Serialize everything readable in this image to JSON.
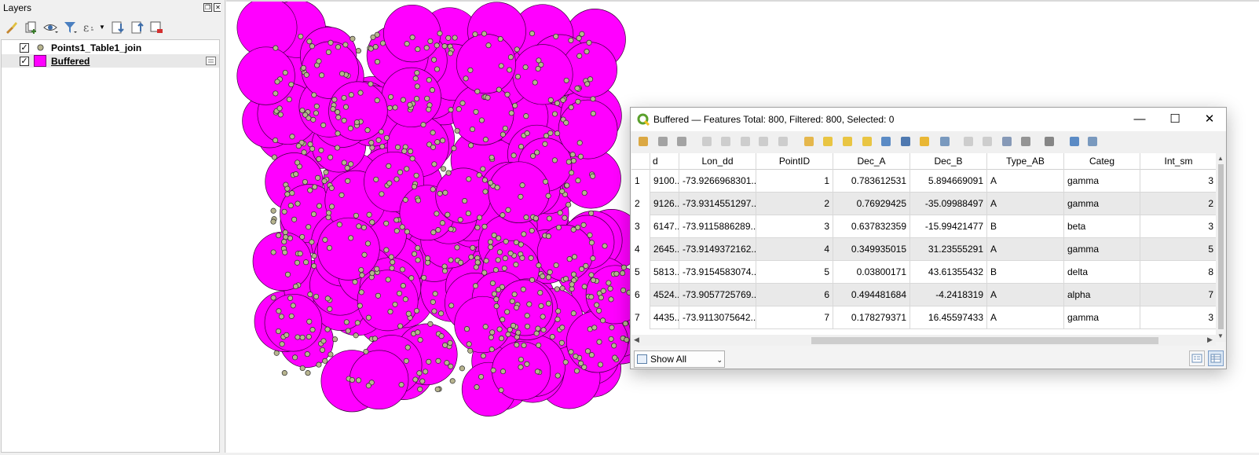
{
  "layers_panel": {
    "title": "Layers",
    "toolbar_icons": [
      "style-brush-icon",
      "add-group-icon",
      "visibility-eye-icon",
      "filter-icon",
      "expression-filter-icon",
      "expand-all-icon",
      "collapse-all-icon",
      "remove-layer-icon"
    ],
    "layers": [
      {
        "name": "Points1_Table1_join",
        "checked": true,
        "symbol": "point",
        "symbol_color": "#b7b48f",
        "selected": false
      },
      {
        "name": "Buffered",
        "checked": true,
        "symbol": "polygon",
        "symbol_color": "#ff00ff",
        "selected": true
      }
    ]
  },
  "map": {
    "polygon_fill": "#ff00ff",
    "polygon_stroke": "#3a003a",
    "point_fill": "#b7b48f",
    "point_stroke": "#2a2a2a"
  },
  "attribute_table": {
    "title": "Buffered — Features Total: 800, Filtered: 800, Selected: 0",
    "columns": [
      "d",
      "Lon_dd",
      "PointID",
      "Dec_A",
      "Dec_B",
      "Type_AB",
      "Categ",
      "Int_sm"
    ],
    "rows": [
      {
        "num": "1",
        "cells": [
          "9100...",
          "-73.9266968301...",
          "1",
          "0.783612531",
          "5.894669091",
          "A",
          "gamma",
          "3"
        ]
      },
      {
        "num": "2",
        "cells": [
          "9126...",
          "-73.9314551297...",
          "2",
          "0.76929425",
          "-35.09988497",
          "A",
          "gamma",
          "2"
        ]
      },
      {
        "num": "3",
        "cells": [
          "6147...",
          "-73.9115886289...",
          "3",
          "0.637832359",
          "-15.99421477",
          "B",
          "beta",
          "3"
        ]
      },
      {
        "num": "4",
        "cells": [
          "2645...",
          "-73.9149372162...",
          "4",
          "0.349935015",
          "31.23555291",
          "A",
          "gamma",
          "5"
        ]
      },
      {
        "num": "5",
        "cells": [
          "5813...",
          "-73.9154583074...",
          "5",
          "0.03800171",
          "43.61355432",
          "B",
          "delta",
          "8"
        ]
      },
      {
        "num": "6",
        "cells": [
          "4524...",
          "-73.9057725769...",
          "6",
          "0.494481684",
          "-4.2418319",
          "A",
          "alpha",
          "7"
        ]
      },
      {
        "num": "7",
        "cells": [
          "4435...",
          "-73.9113075642...",
          "7",
          "0.178279371",
          "16.45597433",
          "A",
          "gamma",
          "3"
        ]
      }
    ],
    "show_all_label": "Show All Features",
    "toolbar_icons": [
      "toggle-editing-icon",
      "multi-edit-icon",
      "save-edits-icon",
      "reload-icon",
      "add-feature-icon",
      "delete-feature-icon",
      "cut-icon",
      "copy-icon",
      "paste-icon",
      "select-expression-icon",
      "select-all-icon",
      "invert-selection-icon",
      "deselect-all-icon",
      "filter-selected-icon",
      "move-selection-top-icon",
      "pan-to-selected-icon",
      "zoom-to-selected-icon",
      "new-field-icon",
      "delete-field-icon",
      "field-calculator-icon",
      "conditional-formatting-icon",
      "actions-icon",
      "dock-icon",
      "attribute-form-icon"
    ]
  }
}
